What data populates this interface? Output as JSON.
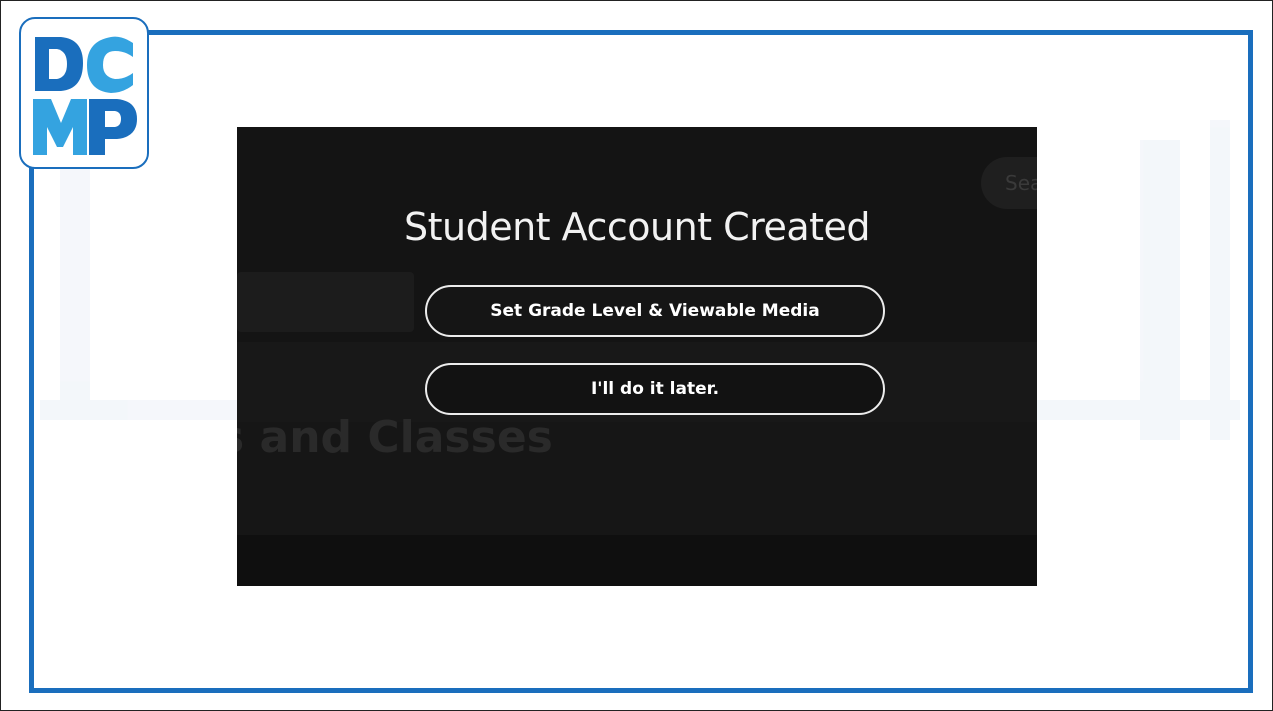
{
  "logo": {
    "text": "DCMP",
    "colors": {
      "primary": "#1a6ebd",
      "secondary": "#34a3e0"
    }
  },
  "dialog": {
    "title": "Student Account Created",
    "primary_button": "Set Grade Level & Viewable Media",
    "secondary_button": "I'll do it later."
  },
  "background": {
    "search_text": "Sea",
    "heading_text": "ts and Classes"
  },
  "colors": {
    "frame_border": "#1a6ebd",
    "overlay_background": "#141414",
    "button_border": "#ececec"
  }
}
